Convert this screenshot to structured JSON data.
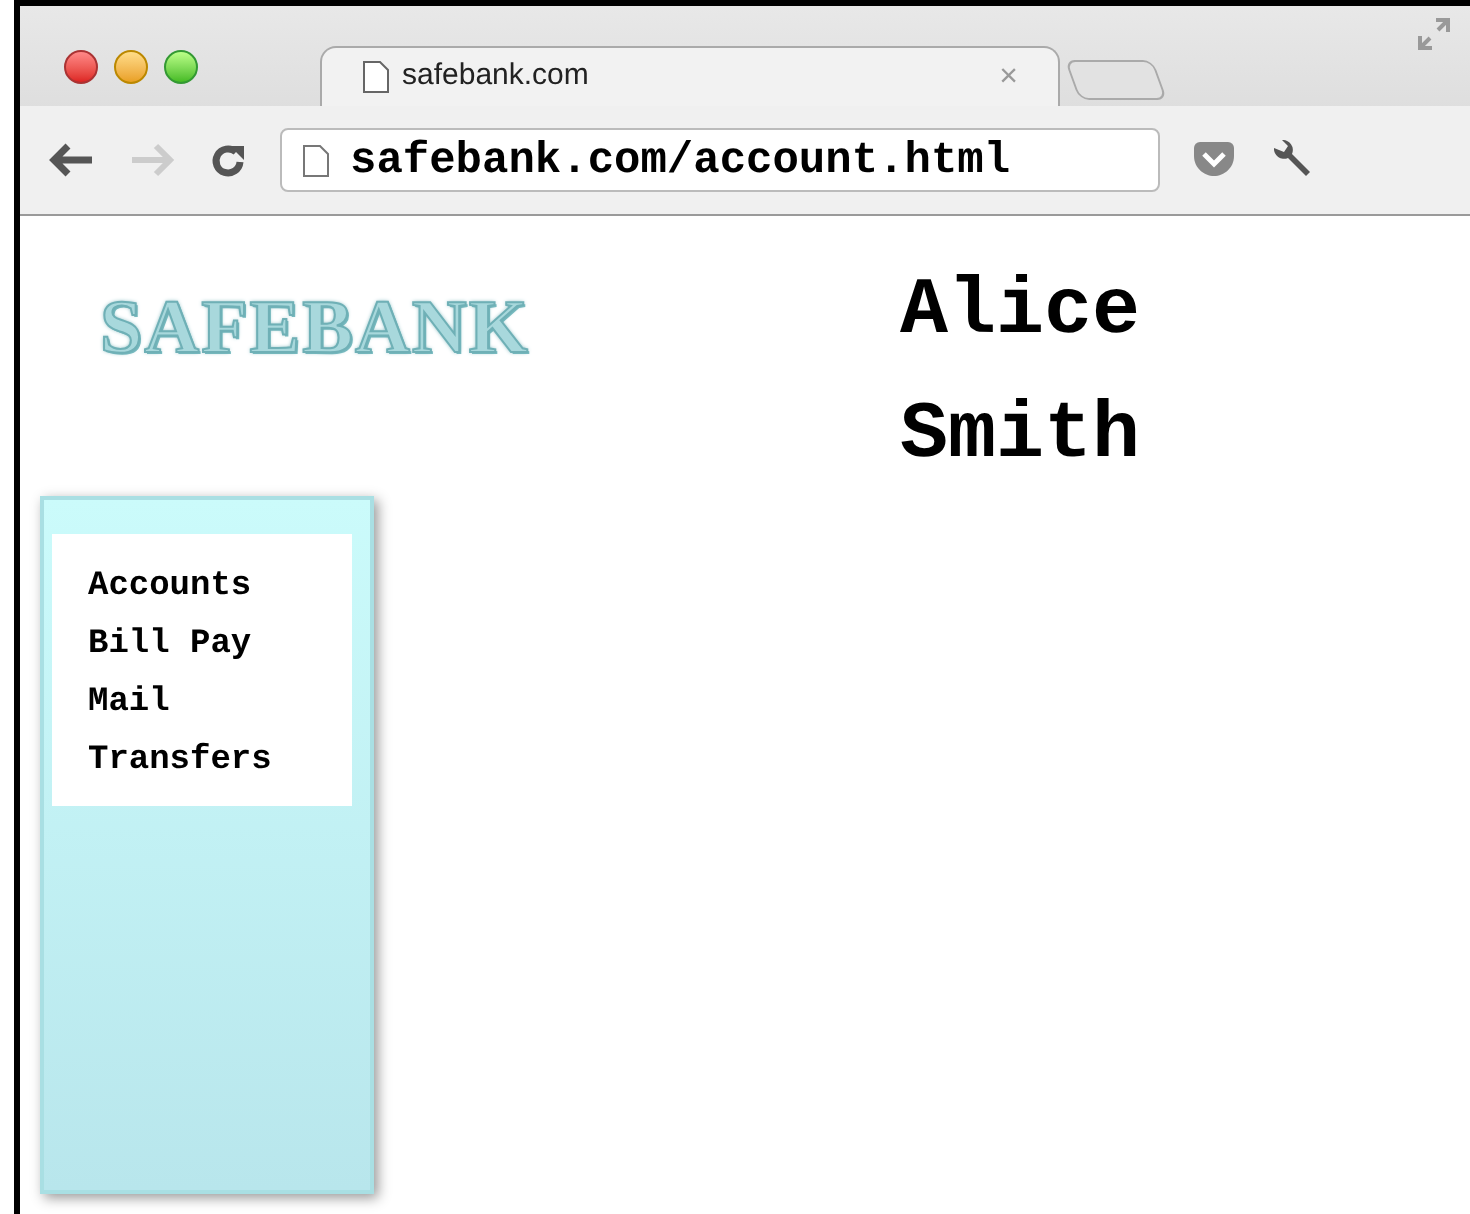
{
  "browser": {
    "tab": {
      "title": "safebank.com",
      "close": "×"
    },
    "address": "safebank.com/account.html"
  },
  "logo": "SAFEBANK",
  "user_name": "Alice Smith",
  "nav": [
    {
      "label": "Accounts"
    },
    {
      "label": "Bill Pay"
    },
    {
      "label": "Mail"
    },
    {
      "label": "Transfers"
    }
  ]
}
